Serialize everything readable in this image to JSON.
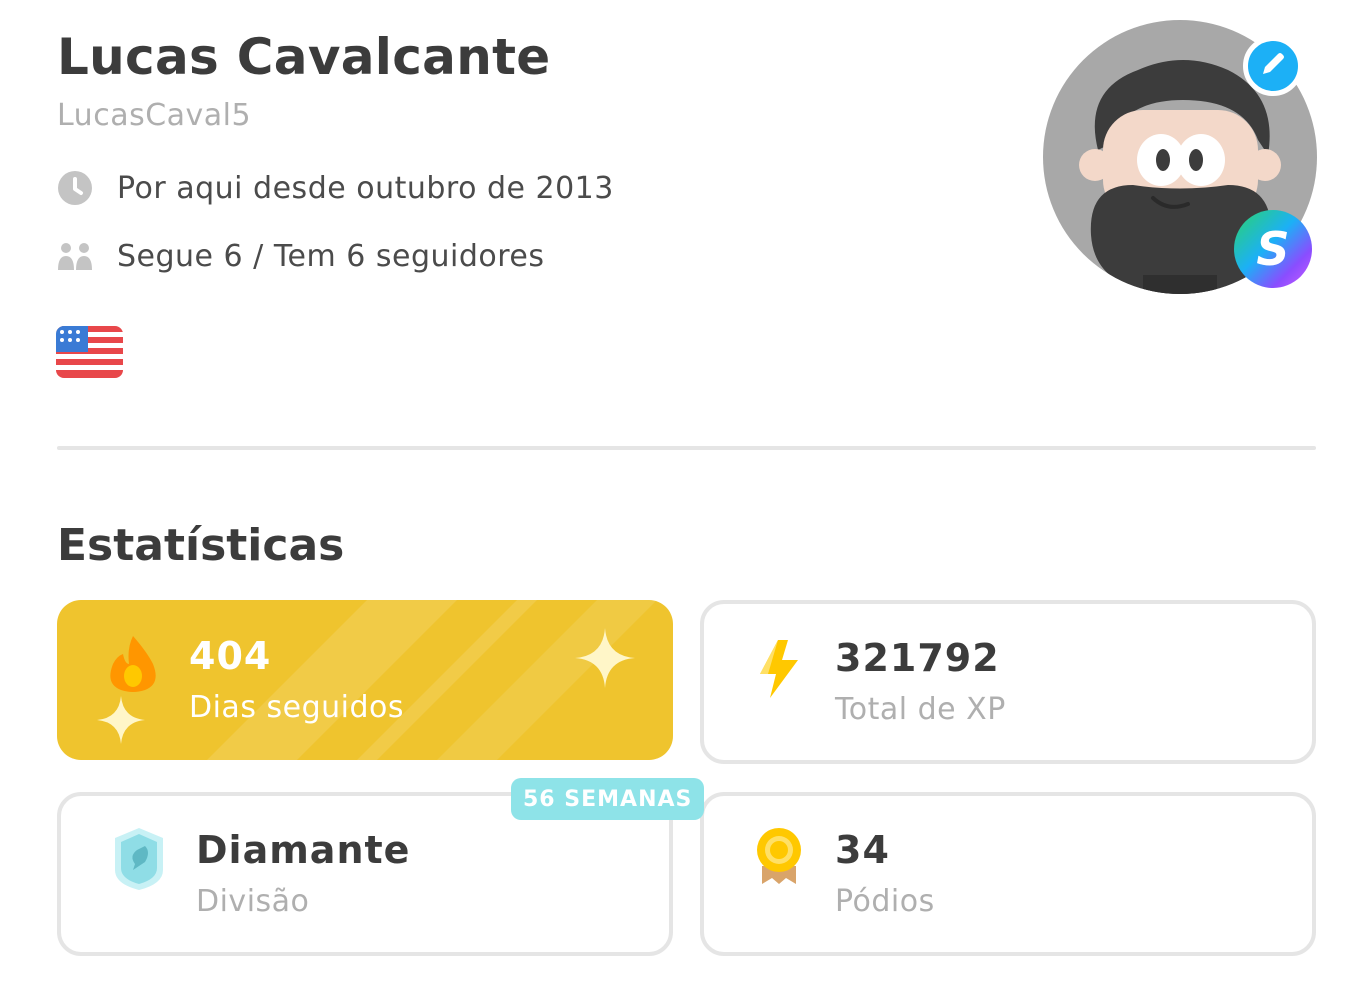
{
  "profile": {
    "name": "Lucas Cavalcante",
    "username": "LucasCaval5",
    "joined": "Por aqui desde outubro de 2013",
    "follow": "Segue 6 / Tem 6 seguidores",
    "icons": {
      "joined": "clock-icon",
      "follow": "people-icon",
      "flag": "us-flag-icon",
      "edit": "pencil-icon",
      "super": "super-badge-icon"
    },
    "super_badge_letter": "S"
  },
  "stats": {
    "title": "Estatísticas",
    "streak": {
      "value": "404",
      "label": "Dias seguidos",
      "icon": "fire-icon"
    },
    "xp": {
      "value": "321792",
      "label": "Total de XP",
      "icon": "lightning-icon"
    },
    "league": {
      "value": "Diamante",
      "label": "Divisão",
      "badge": "56 SEMANAS",
      "icon": "diamond-league-icon"
    },
    "podium": {
      "value": "34",
      "label": "Pódios",
      "icon": "medal-icon"
    }
  },
  "colors": {
    "streak_card": "#efc42e",
    "edit_button": "#1cb0f6",
    "weeks_badge": "#8ee3e8",
    "text_primary": "#3c3c3c",
    "text_muted": "#afafaf"
  }
}
